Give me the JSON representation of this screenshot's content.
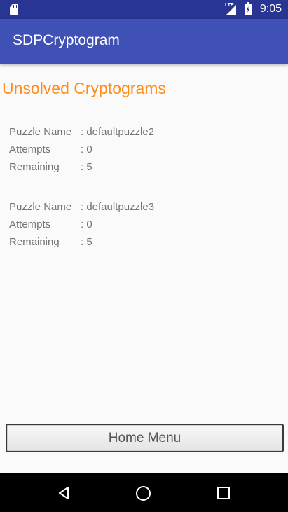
{
  "status_bar": {
    "network_label": "LTE",
    "time": "9:05",
    "icons": [
      "sd-card-icon",
      "lte-signal-icon",
      "battery-charging-icon"
    ]
  },
  "app_bar": {
    "title": "SDPCryptogram"
  },
  "page": {
    "title": "Unsolved Cryptograms",
    "title_color": "#ff8c1a"
  },
  "puzzles": [
    {
      "name_label": "Puzzle Name",
      "name_value": ": defaultpuzzle2",
      "attempts_label": "Attempts",
      "attempts_value": ": 0",
      "remaining_label": "Remaining",
      "remaining_value": ": 5"
    },
    {
      "name_label": "Puzzle Name",
      "name_value": ": defaultpuzzle3",
      "attempts_label": "Attempts",
      "attempts_value": ": 0",
      "remaining_label": "Remaining",
      "remaining_value": ": 5"
    }
  ],
  "home_button": {
    "label": "Home Menu"
  },
  "nav_bar": {
    "icons": [
      "back-icon",
      "home-icon",
      "recents-icon"
    ]
  },
  "colors": {
    "status_bar": "#283593",
    "app_bar": "#3f51b5",
    "background": "#fafafa"
  }
}
